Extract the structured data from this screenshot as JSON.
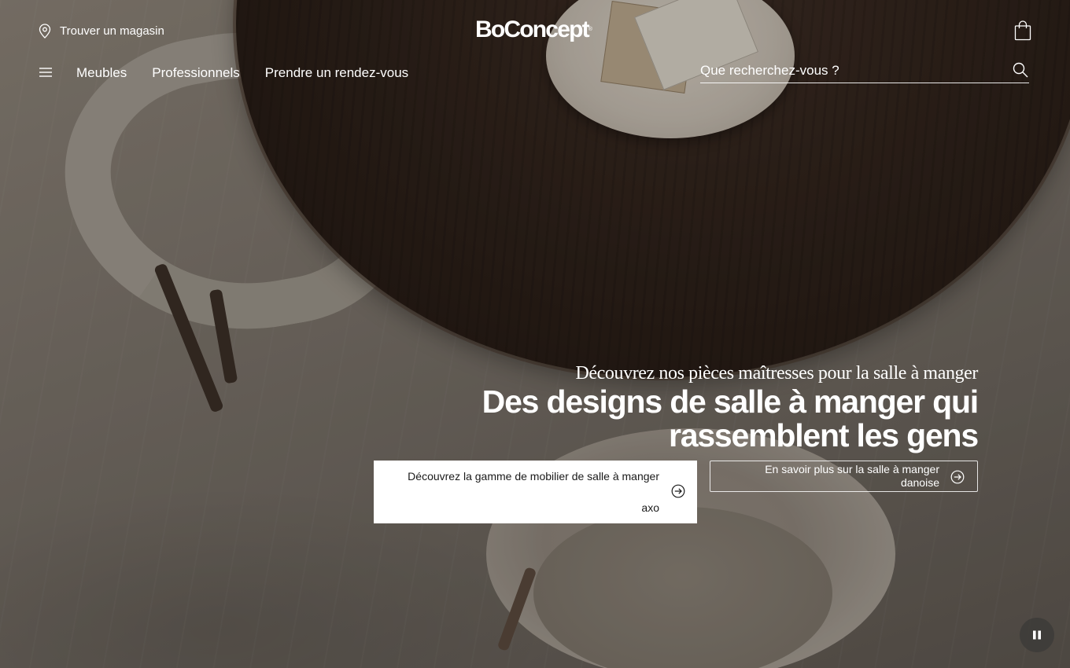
{
  "header": {
    "store_locator_label": "Trouver un magasin",
    "logo_text": "BoConcept",
    "logo_mark": "®",
    "nav_items": [
      "Meubles",
      "Professionnels",
      "Prendre un rendez-vous"
    ],
    "search_placeholder": "Que recherchez-vous ?",
    "icons": {
      "store": "location-pin-icon",
      "cart": "shopping-bag-icon",
      "menu": "hamburger-menu-icon",
      "search": "search-icon"
    }
  },
  "hero": {
    "kicker": "Découvrez nos pièces maîtresses pour la salle à manger",
    "headline_line1": "Des designs de salle à manger qui",
    "headline_line2": "rassemblent les gens",
    "cta_primary": {
      "label_line1": "Découvrez la gamme de mobilier de salle à manger",
      "label_line2": "axo",
      "icon": "arrow-right-circle-icon"
    },
    "cta_secondary": {
      "label_line1": "En savoir plus sur la salle à manger",
      "label_line2": "danoise",
      "icon": "arrow-right-circle-icon"
    },
    "pause_icon": "pause-icon"
  },
  "colors": {
    "text_on_hero": "#ffffff",
    "cta_primary_bg": "#ffffff",
    "cta_primary_text": "#1a1a1a",
    "pause_bg": "#3c3a38"
  }
}
